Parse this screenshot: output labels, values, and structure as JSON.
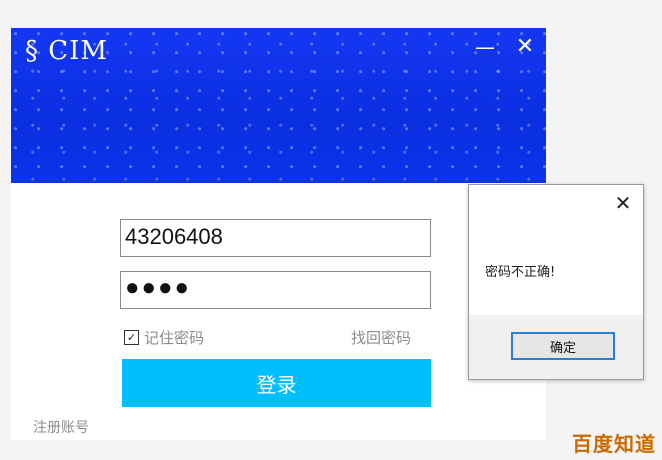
{
  "login_window": {
    "title": "§ CIM",
    "minimize_glyph": "—",
    "close_glyph": "✕",
    "username_value": "43206408",
    "password_masked": "●●●●",
    "remember_label": "记住密码",
    "remember_checked": true,
    "forgot_label": "找回密码",
    "login_label": "登录",
    "register_label": "注册账号",
    "colors": {
      "banner": "#0b33ea",
      "login_button": "#00bfff"
    }
  },
  "dialog": {
    "close_glyph": "✕",
    "message": "密码不正确!",
    "ok_label": "确定"
  },
  "watermark": {
    "text": "百度知道"
  }
}
